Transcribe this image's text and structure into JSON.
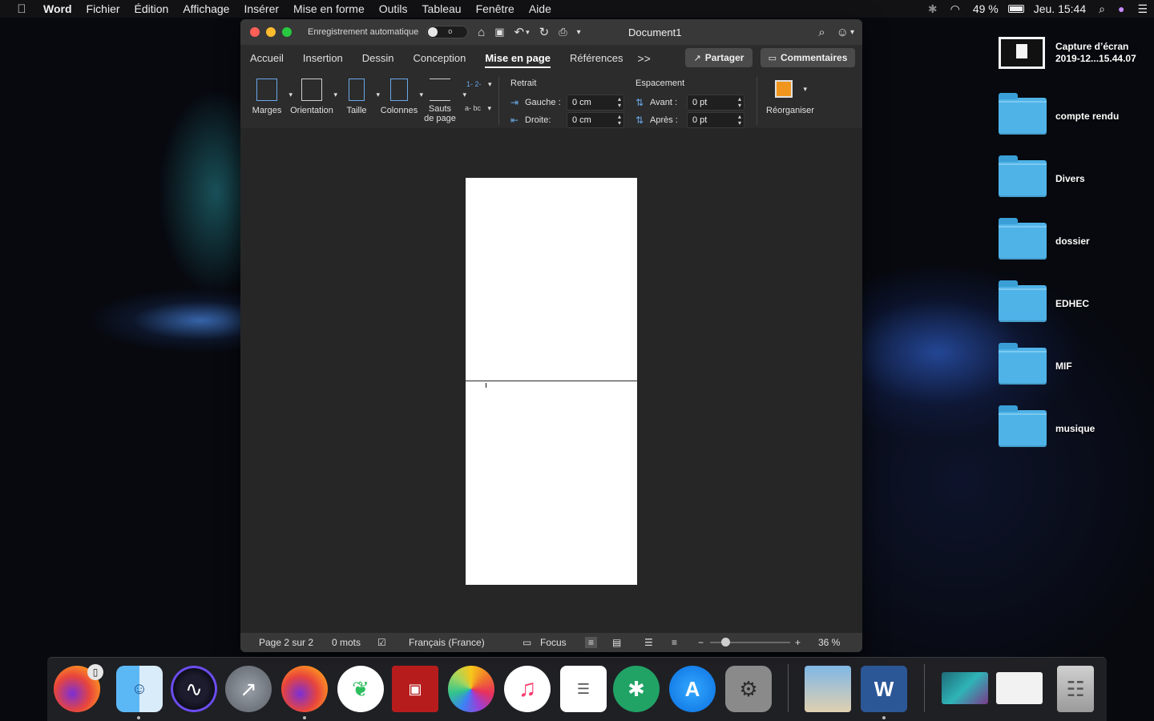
{
  "menubar": {
    "apple": "",
    "app_name": "Word",
    "items": [
      "Fichier",
      "Édition",
      "Affichage",
      "Insérer",
      "Mise en forme",
      "Outils",
      "Tableau",
      "Fenêtre",
      "Aide"
    ],
    "battery": "49 %",
    "clock": "Jeu. 15:44"
  },
  "window": {
    "autosave_label": "Enregistrement automatique",
    "autosave_state": "o",
    "doc_title": "Document1"
  },
  "tabs": {
    "items": [
      "Accueil",
      "Insertion",
      "Dessin",
      "Conception",
      "Mise en page",
      "Références"
    ],
    "active": "Mise en page",
    "more": ">>",
    "share": "Partager",
    "comments": "Commentaires"
  },
  "ribbon": {
    "margins": "Marges",
    "orientation": "Orientation",
    "size": "Taille",
    "columns": "Colonnes",
    "breaks_line1": "Sauts",
    "breaks_line2": "de page",
    "line_numbers_icon": "1- 2-",
    "hyphenation_icon": "a- bc",
    "indent_title": "Retrait",
    "indent_left_label": "Gauche :",
    "indent_left_value": "0 cm",
    "indent_right_label": "Droite:",
    "indent_right_value": "0 cm",
    "spacing_title": "Espacement",
    "spacing_before_label": "Avant :",
    "spacing_before_value": "0 pt",
    "spacing_after_label": "Après :",
    "spacing_after_value": "0 pt",
    "arrange": "Réorganiser"
  },
  "statusbar": {
    "page": "Page 2 sur 2",
    "words": "0 mots",
    "language": "Français (France)",
    "focus": "Focus",
    "zoom_minus": "−",
    "zoom_plus": "+",
    "zoom": "36 %"
  },
  "desktop": {
    "screenshot_line1": "Capture d’écran",
    "screenshot_line2": "2019-12...15.44.07",
    "folders": [
      "compte rendu",
      "Divers",
      "dossier",
      "EDHEC",
      "MIF",
      "musique"
    ]
  },
  "dock": {
    "apps": [
      "Firefox",
      "Finder",
      "Siri",
      "Launchpad",
      "Firefox",
      "Evernote",
      "Photo Booth",
      "Photos",
      "iTunes",
      "Rappels",
      "Gitter",
      "App Store",
      "Préférences Système",
      "Aperçu",
      "Word"
    ],
    "firefox_badge": "",
    "word_letter": "W"
  },
  "colors": {
    "accent_blue": "#6aa8e8",
    "folder_blue": "#4fb3e8",
    "word_blue": "#2b5797",
    "arrange_orange": "#f0961e"
  }
}
